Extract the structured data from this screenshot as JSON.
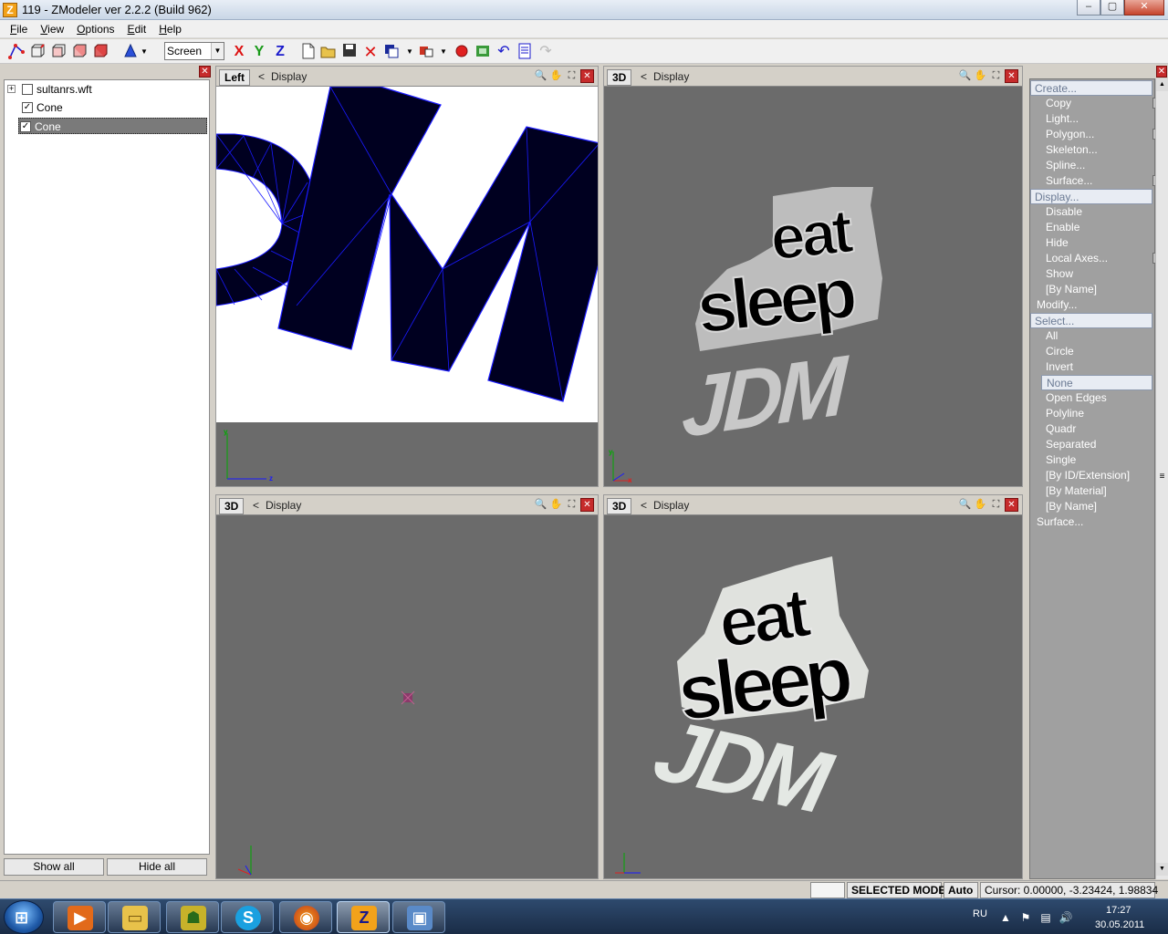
{
  "window": {
    "title": "119 - ZModeler ver 2.2.2 (Build 962)",
    "icon": "Z",
    "minimize": "–",
    "maximize": "▢",
    "close": "✕"
  },
  "menu": {
    "items": [
      {
        "accel": "F",
        "rest": "ile"
      },
      {
        "accel": "V",
        "rest": "iew"
      },
      {
        "accel": "O",
        "rest": "ptions"
      },
      {
        "accel": "E",
        "rest": "dit"
      },
      {
        "accel": "H",
        "rest": "elp"
      }
    ]
  },
  "toolbar": {
    "coord_mode": "Screen",
    "axis_x": "X",
    "axis_y": "Y",
    "axis_z": "Z"
  },
  "tree": {
    "items": [
      {
        "label": "sultanrs.wft",
        "checked": false
      },
      {
        "label": "Cone",
        "checked": true
      },
      {
        "label": "Cone",
        "checked": true
      }
    ],
    "show_all": "Show all",
    "hide_all": "Hide all",
    "expand_symbol": "+",
    "check_symbol": "✓"
  },
  "viewports": {
    "top_left": {
      "tab": "Left",
      "display": "Display"
    },
    "top_right": {
      "tab": "3D",
      "display": "Display"
    },
    "bottom_left": {
      "tab": "3D",
      "display": "Display"
    },
    "bottom_right": {
      "tab": "3D",
      "display": "Display"
    },
    "back_symbol": "<",
    "axis_y": "y",
    "axis_z": "z",
    "axis_x": "x"
  },
  "decal": {
    "line1": "eat",
    "line2": "sleep",
    "line3": "JDM"
  },
  "commands": {
    "create": {
      "label": "Create...",
      "items": [
        "Copy",
        "Light...",
        "Polygon...",
        "Skeleton...",
        "Spline...",
        "Surface..."
      ]
    },
    "display": {
      "label": "Display...",
      "items": [
        "Disable",
        "Enable",
        "Hide",
        "Local Axes...",
        "Show",
        "[By Name]"
      ]
    },
    "modify": {
      "label": "Modify..."
    },
    "select": {
      "label": "Select...",
      "items": [
        "All",
        "Circle",
        "Invert",
        "None",
        "Open Edges",
        "Polyline",
        "Quadr",
        "Separated",
        "Single",
        "[By ID/Extension]",
        "[By Material]",
        "[By Name]"
      ]
    },
    "surface": {
      "label": "Surface..."
    }
  },
  "status": {
    "mode": "SELECTED MODE",
    "auto": "Auto",
    "cursor": "Cursor: 0.00000, -3.23424, 1.98834"
  },
  "taskbar": {
    "lang": "RU",
    "time": "17:27",
    "date": "30.05.2011",
    "z_label": "Z",
    "skype_label": "S"
  },
  "colors": {
    "mesh_fill": "#000020",
    "mesh_edge": "#1a1aff",
    "viewport_bg": "#6b6b6b",
    "panel_bg": "#d4d0c8",
    "accent": "#f2a21a"
  }
}
